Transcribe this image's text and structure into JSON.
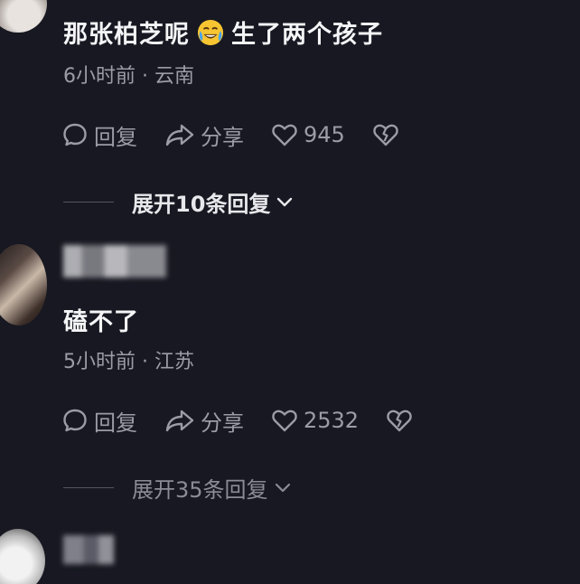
{
  "comments": [
    {
      "text_before_emoji": "那张柏芝呢",
      "emoji_icon": "crying-laughing-emoji-icon",
      "text_after_emoji": "生了两个孩子",
      "meta": "6小时前 · 云南",
      "reply_label": "回复",
      "share_label": "分享",
      "like_count": "945",
      "expand_label": "展开10条回复"
    },
    {
      "text": "磕不了",
      "meta": "5小时前 · 江苏",
      "reply_label": "回复",
      "share_label": "分享",
      "like_count": "2532",
      "expand_label": "展开35条回复"
    }
  ],
  "colors": {
    "background": "#171821",
    "primary_text": "#f5f5f7",
    "secondary_text": "#9c9ca6"
  }
}
